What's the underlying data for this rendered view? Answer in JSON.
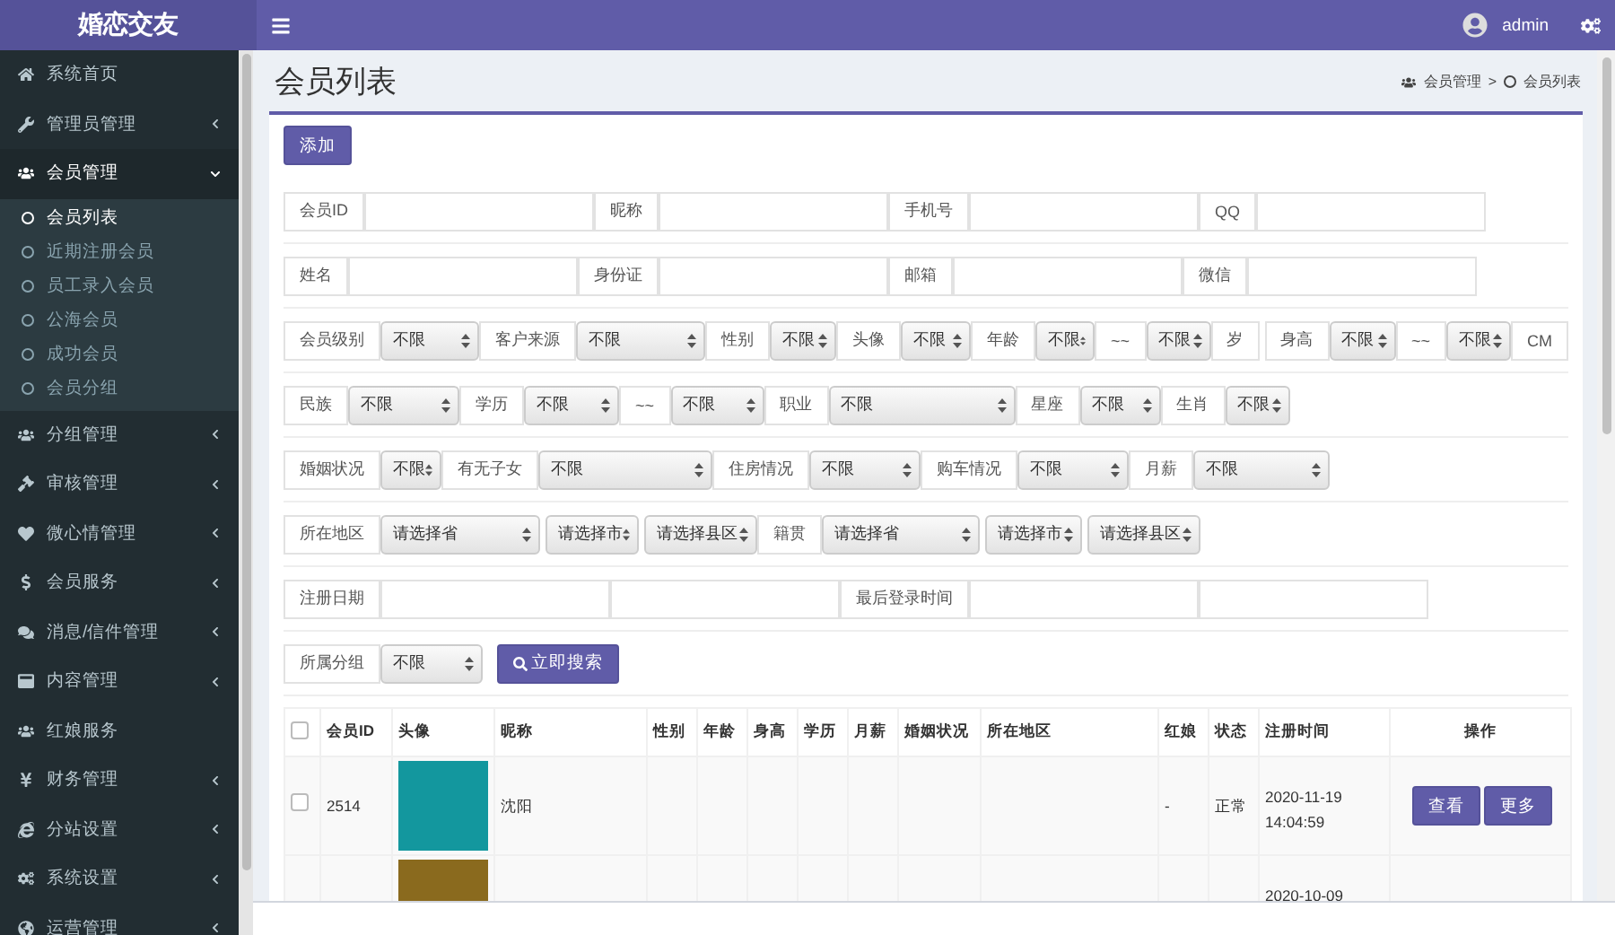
{
  "header": {
    "logo": "婚恋交友",
    "user": "admin"
  },
  "sidebar": {
    "items": [
      {
        "label": "系统首页"
      },
      {
        "label": "管理员管理",
        "expanded": false
      },
      {
        "label": "会员管理",
        "expanded": true,
        "children": [
          {
            "label": "会员列表",
            "selected": true
          },
          {
            "label": "近期注册会员",
            "selected": false
          },
          {
            "label": "员工录入会员",
            "selected": false
          },
          {
            "label": "公海会员",
            "selected": false
          },
          {
            "label": "成功会员",
            "selected": false
          },
          {
            "label": "会员分组",
            "selected": false
          }
        ]
      },
      {
        "label": "分组管理",
        "expanded": false
      },
      {
        "label": "审核管理",
        "expanded": false
      },
      {
        "label": "微心情管理",
        "expanded": false
      },
      {
        "label": "会员服务",
        "expanded": false
      },
      {
        "label": "消息/信件管理",
        "expanded": false
      },
      {
        "label": "内容管理",
        "expanded": false
      },
      {
        "label": "红娘服务"
      },
      {
        "label": "财务管理",
        "expanded": false
      },
      {
        "label": "分站设置",
        "expanded": false
      },
      {
        "label": "系统设置",
        "expanded": false
      },
      {
        "label": "运营管理",
        "expanded": false
      }
    ]
  },
  "page": {
    "title": "会员列表",
    "breadcrumb": [
      "会员管理",
      "会员列表"
    ],
    "separator": ">"
  },
  "add_button": "添加",
  "filters": [
    [
      {
        "kind": "label",
        "text": "会员ID"
      },
      {
        "kind": "input"
      },
      {
        "kind": "label",
        "text": "昵称"
      },
      {
        "kind": "input"
      },
      {
        "kind": "label",
        "text": "手机号"
      },
      {
        "kind": "input"
      },
      {
        "kind": "label",
        "text": "QQ"
      },
      {
        "kind": "input"
      }
    ],
    [
      {
        "kind": "label",
        "text": "姓名"
      },
      {
        "kind": "input"
      },
      {
        "kind": "label",
        "text": "身份证"
      },
      {
        "kind": "input"
      },
      {
        "kind": "label",
        "text": "邮箱"
      },
      {
        "kind": "input"
      },
      {
        "kind": "label",
        "text": "微信"
      },
      {
        "kind": "input"
      }
    ],
    [
      {
        "kind": "label",
        "text": "会员级别"
      },
      {
        "kind": "select",
        "value": "不限"
      },
      {
        "kind": "label",
        "text": "客户来源"
      },
      {
        "kind": "select",
        "value": "不限"
      },
      {
        "kind": "label",
        "text": "性别"
      },
      {
        "kind": "select",
        "value": "不限"
      },
      {
        "kind": "label",
        "text": "头像"
      },
      {
        "kind": "select",
        "value": "不限"
      },
      {
        "kind": "label",
        "text": "年龄"
      },
      {
        "kind": "select",
        "value": "不限"
      },
      {
        "kind": "label",
        "text": "~~"
      },
      {
        "kind": "select",
        "value": "不限"
      },
      {
        "kind": "label",
        "text": "岁"
      },
      {
        "kind": "label",
        "text": "身高"
      },
      {
        "kind": "select",
        "value": "不限"
      },
      {
        "kind": "label",
        "text": "~~"
      },
      {
        "kind": "select",
        "value": "不限"
      },
      {
        "kind": "label",
        "text": "CM"
      }
    ],
    [
      {
        "kind": "label",
        "text": "民族"
      },
      {
        "kind": "select",
        "value": "不限"
      },
      {
        "kind": "label",
        "text": "学历"
      },
      {
        "kind": "select",
        "value": "不限"
      },
      {
        "kind": "label",
        "text": "~~"
      },
      {
        "kind": "select",
        "value": "不限"
      },
      {
        "kind": "label",
        "text": "职业"
      },
      {
        "kind": "select",
        "value": "不限"
      },
      {
        "kind": "label",
        "text": "星座"
      },
      {
        "kind": "select",
        "value": "不限"
      },
      {
        "kind": "label",
        "text": "生肖"
      },
      {
        "kind": "select",
        "value": "不限"
      }
    ],
    [
      {
        "kind": "label",
        "text": "婚姻状况"
      },
      {
        "kind": "select",
        "value": "不限"
      },
      {
        "kind": "label",
        "text": "有无子女"
      },
      {
        "kind": "select",
        "value": "不限"
      },
      {
        "kind": "label",
        "text": "住房情况"
      },
      {
        "kind": "select",
        "value": "不限"
      },
      {
        "kind": "label",
        "text": "购车情况"
      },
      {
        "kind": "select",
        "value": "不限"
      },
      {
        "kind": "label",
        "text": "月薪"
      },
      {
        "kind": "select",
        "value": "不限"
      }
    ],
    [
      {
        "kind": "label",
        "text": "所在地区"
      },
      {
        "kind": "select",
        "value": "请选择省"
      },
      {
        "kind": "select",
        "value": "请选择市"
      },
      {
        "kind": "select",
        "value": "请选择县区"
      },
      {
        "kind": "label",
        "text": "籍贯"
      },
      {
        "kind": "select",
        "value": "请选择省"
      },
      {
        "kind": "select",
        "value": "请选择市"
      },
      {
        "kind": "select",
        "value": "请选择县区"
      }
    ],
    [
      {
        "kind": "label",
        "text": "注册日期"
      },
      {
        "kind": "input"
      },
      {
        "kind": "input"
      },
      {
        "kind": "label",
        "text": "最后登录时间"
      },
      {
        "kind": "input"
      },
      {
        "kind": "input"
      }
    ],
    [
      {
        "kind": "label",
        "text": "所属分组"
      },
      {
        "kind": "select",
        "value": "不限"
      },
      {
        "kind": "button",
        "text": "立即搜索"
      }
    ]
  ],
  "table": {
    "header_checked": false,
    "columns": [
      "会员ID",
      "头像",
      "昵称",
      "性别",
      "年龄",
      "身高",
      "学历",
      "月薪",
      "婚姻状况",
      "所在地区",
      "红娘",
      "状态",
      "注册时间",
      "操作"
    ],
    "rows": [
      {
        "checked": false,
        "id": "2514",
        "nickname": "沈阳",
        "matchmaker": "-",
        "status": "正常",
        "registered": "2020-11-19 14:04:59",
        "actions": [
          "查看",
          "更多"
        ]
      },
      {
        "registered": "2020-10-09"
      }
    ]
  }
}
